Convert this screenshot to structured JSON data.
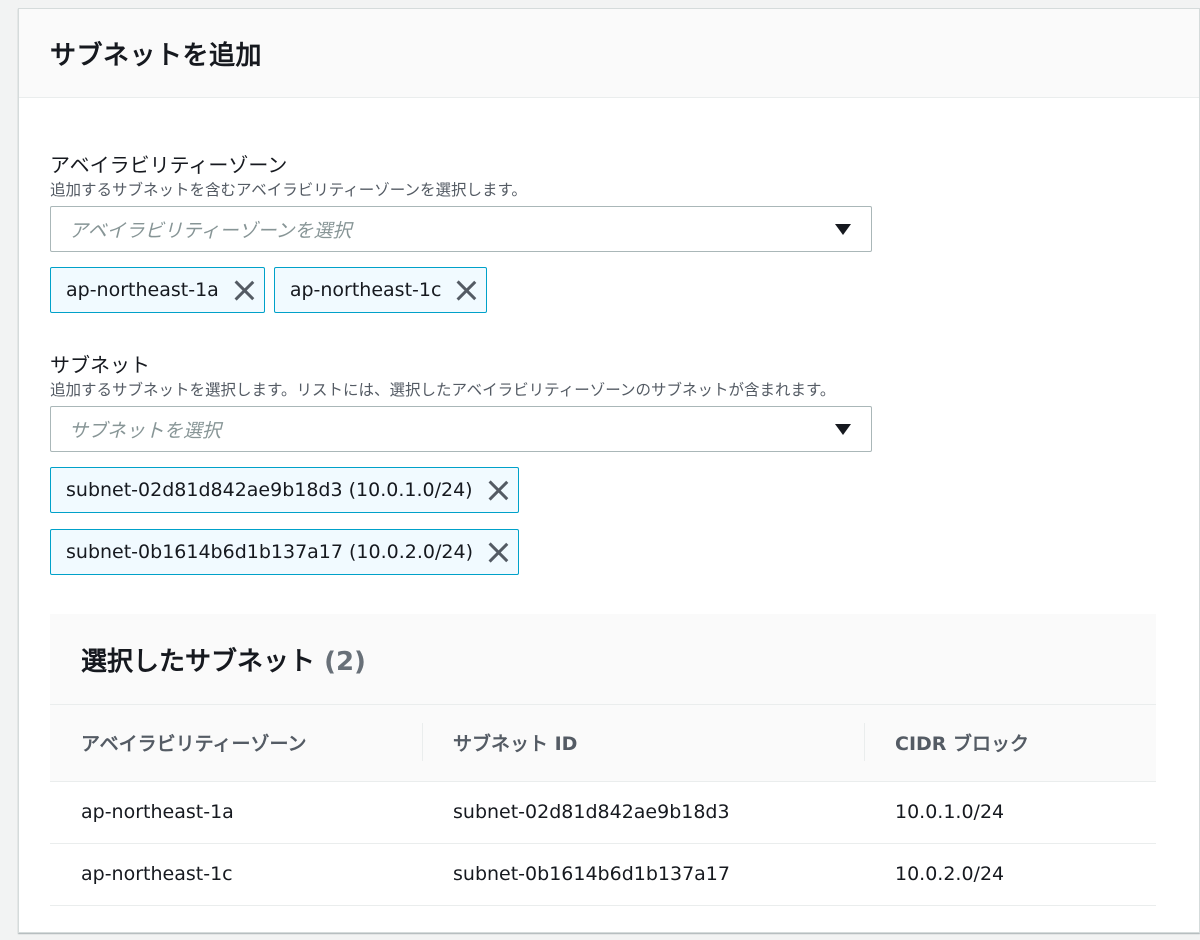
{
  "header": {
    "title": "サブネットを追加"
  },
  "availability_zone": {
    "label": "アベイラビリティーゾーン",
    "description": "追加するサブネットを含むアベイラビリティーゾーンを選択します。",
    "placeholder": "アベイラビリティーゾーンを選択",
    "tokens": [
      "ap-northeast-1a",
      "ap-northeast-1c"
    ]
  },
  "subnet": {
    "label": "サブネット",
    "description": "追加するサブネットを選択します。リストには、選択したアベイラビリティーゾーンのサブネットが含まれます。",
    "placeholder": "サブネットを選択",
    "tokens": [
      "subnet-02d81d842ae9b18d3 (10.0.1.0/24)",
      "subnet-0b1614b6d1b137a17 (10.0.2.0/24)"
    ]
  },
  "selected_table": {
    "title": "選択したサブネット",
    "count": "(2)",
    "columns": [
      "アベイラビリティーゾーン",
      "サブネット ID",
      "CIDR ブロック"
    ],
    "rows": [
      [
        "ap-northeast-1a",
        "subnet-02d81d842ae9b18d3",
        "10.0.1.0/24"
      ],
      [
        "ap-northeast-1c",
        "subnet-0b1614b6d1b137a17",
        "10.0.2.0/24"
      ]
    ]
  },
  "colors": {
    "token_border": "#00a1c9",
    "token_bg": "#f1faff",
    "text": "#16191f",
    "muted": "#545b64"
  }
}
